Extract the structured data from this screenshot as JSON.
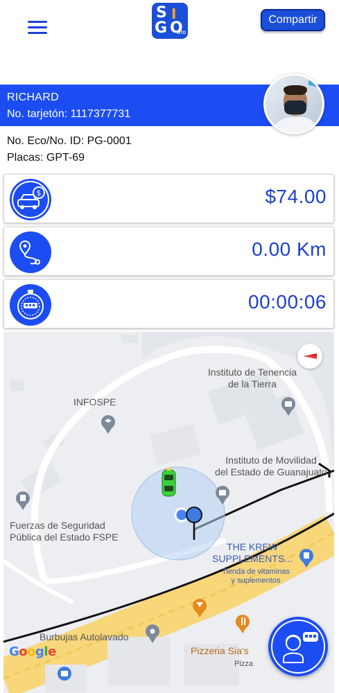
{
  "header": {
    "logo_letters": [
      "S",
      "I",
      "G",
      "O"
    ],
    "logo_sub": "GTO",
    "share_label": "Compartir",
    "menu_icon": "hamburger-menu-icon"
  },
  "driver": {
    "name": "RICHARD",
    "card_label": "No. tarjetón: 1117377731",
    "eco_label": "No. Eco/No. ID: PG-0001",
    "plates_label": "Placas: GPT-69"
  },
  "stats": {
    "fare": "$74.00",
    "distance": "0.00 Km",
    "time": "00:00:06"
  },
  "map": {
    "labels": {
      "instituto_tenencia": "Instituto de Tenencia\nde la Tierra",
      "infospe": "INFOSPE",
      "instituto_movilidad": "Instituto de Movilidad\ndel Estado de Guanajuato",
      "fuerzas": "Fuerzas de Seguridad\nPública del Estado FSPE",
      "krew": "THE KREW\nSUPPLEMENTS...",
      "tienda": "Tienda de vitaminas\ny suplementos",
      "burbujas": "Burbujas Autolavado",
      "pizzeria": "Pizzeria Sia's",
      "pizza": "Pizza"
    },
    "attribution": "Google"
  },
  "colors": {
    "brand_blue": "#1c4df2",
    "value_blue": "#1c3fd0",
    "car_green": "#3ad13a",
    "road_yellow": "#f7d77a"
  }
}
